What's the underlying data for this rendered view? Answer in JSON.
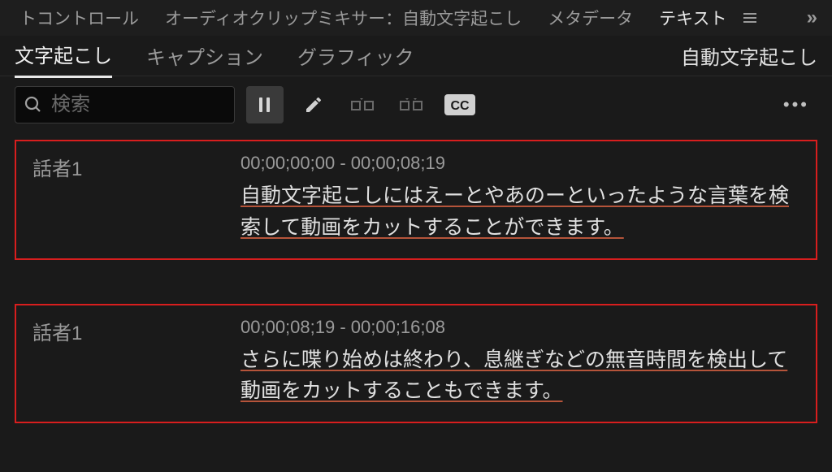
{
  "top_tabs": {
    "items": [
      "トコントロール",
      "オーディオクリップミキサー：自動文字起こし",
      "メタデータ",
      "テキスト"
    ],
    "active_index": 3,
    "overflow": "»"
  },
  "sub_tabs": {
    "items": [
      "文字起こし",
      "キャプション",
      "グラフィック"
    ],
    "active_index": 0,
    "right_label": "自動文字起こし"
  },
  "search": {
    "placeholder": "検索"
  },
  "toolbar": {
    "btn_pause_detect": "pause",
    "btn_edit": "edit",
    "btn_merge": "merge",
    "btn_split": "split",
    "btn_cc": "CC"
  },
  "transcript": [
    {
      "speaker": "話者1",
      "time": "00;00;00;00 - 00;00;08;19",
      "text": "自動文字起こしにはえーとやあのーといったような言葉を検索して動画をカットすることができます。"
    },
    {
      "speaker": "話者1",
      "time": "00;00;08;19 - 00;00;16;08",
      "text": "さらに喋り始めは終わり、息継ぎなどの無音時間を検出して動画をカットすることもできます。"
    }
  ]
}
